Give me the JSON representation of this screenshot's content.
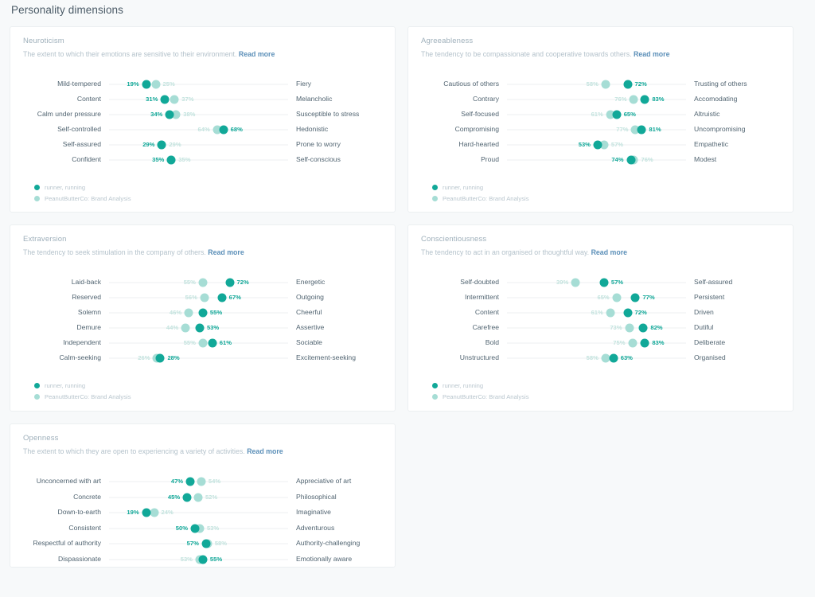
{
  "page": {
    "title": "Personality dimensions",
    "read_more_label": "Read more",
    "accent_dark": "#11a898",
    "accent_light": "#a6ddd5",
    "background": "#f7f9fa"
  },
  "legend": {
    "series_dark": "runner, running",
    "series_light": "PeanutButterCo: Brand Analysis"
  },
  "chart_data": [
    {
      "type": "scatter",
      "id": "neuroticism",
      "title": "Neuroticism",
      "description": "The extent to which their emotions are sensitive to their environment.",
      "xlim": [
        0,
        100
      ],
      "series": [
        {
          "name": "runner, running",
          "color": "#11a898"
        },
        {
          "name": "PeanutButterCo: Brand Analysis",
          "color": "#a6ddd5"
        }
      ],
      "rows": [
        {
          "left": "Mild-tempered",
          "right": "Fiery",
          "dark": 19,
          "light": 25,
          "dark_label": "19%",
          "light_label": "25%"
        },
        {
          "left": "Content",
          "right": "Melancholic",
          "dark": 31,
          "light": 37,
          "dark_label": "31%",
          "light_label": "37%"
        },
        {
          "left": "Calm under pressure",
          "right": "Susceptible to stress",
          "dark": 34,
          "light": 38,
          "dark_label": "34%",
          "light_label": "38%"
        },
        {
          "left": "Self-controlled",
          "right": "Hedonistic",
          "dark": 68,
          "light": 64,
          "dark_label": "68%",
          "light_label": "64%"
        },
        {
          "left": "Self-assured",
          "right": "Prone to worry",
          "dark": 29,
          "light": 29,
          "dark_label": "29%",
          "light_label": "29%"
        },
        {
          "left": "Confident",
          "right": "Self-conscious",
          "dark": 35,
          "light": 35,
          "dark_label": "35%",
          "light_label": "35%"
        }
      ]
    },
    {
      "type": "scatter",
      "id": "agreeableness",
      "title": "Agreeableness",
      "description": "The tendency to be compassionate and cooperative towards others.",
      "xlim": [
        0,
        100
      ],
      "series": [
        {
          "name": "runner, running",
          "color": "#11a898"
        },
        {
          "name": "PeanutButterCo: Brand Analysis",
          "color": "#a6ddd5"
        }
      ],
      "rows": [
        {
          "left": "Cautious of others",
          "right": "Trusting of others",
          "dark": 72,
          "light": 58,
          "dark_label": "72%",
          "light_label": "58%"
        },
        {
          "left": "Contrary",
          "right": "Accomodating",
          "dark": 83,
          "light": 76,
          "dark_label": "83%",
          "light_label": "76%"
        },
        {
          "left": "Self-focused",
          "right": "Altruistic",
          "dark": 65,
          "light": 61,
          "dark_label": "65%",
          "light_label": "61%"
        },
        {
          "left": "Compromising",
          "right": "Uncompromising",
          "dark": 81,
          "light": 77,
          "dark_label": "81%",
          "light_label": "77%"
        },
        {
          "left": "Hard-hearted",
          "right": "Empathetic",
          "dark": 53,
          "light": 57,
          "dark_label": "53%",
          "light_label": "57%"
        },
        {
          "left": "Proud",
          "right": "Modest",
          "dark": 74,
          "light": 76,
          "dark_label": "74%",
          "light_label": "76%"
        }
      ]
    },
    {
      "type": "scatter",
      "id": "extraversion",
      "title": "Extraversion",
      "description": "The tendency to seek stimulation in the company of others.",
      "xlim": [
        0,
        100
      ],
      "series": [
        {
          "name": "runner, running",
          "color": "#11a898"
        },
        {
          "name": "PeanutButterCo: Brand Analysis",
          "color": "#a6ddd5"
        }
      ],
      "rows": [
        {
          "left": "Laid-back",
          "right": "Energetic",
          "dark": 72,
          "light": 55,
          "dark_label": "72%",
          "light_label": "55%"
        },
        {
          "left": "Reserved",
          "right": "Outgoing",
          "dark": 67,
          "light": 56,
          "dark_label": "67%",
          "light_label": "56%"
        },
        {
          "left": "Solemn",
          "right": "Cheerful",
          "dark": 55,
          "light": 46,
          "dark_label": "55%",
          "light_label": "46%"
        },
        {
          "left": "Demure",
          "right": "Assertive",
          "dark": 53,
          "light": 44,
          "dark_label": "53%",
          "light_label": "44%"
        },
        {
          "left": "Independent",
          "right": "Sociable",
          "dark": 61,
          "light": 55,
          "dark_label": "61%",
          "light_label": "55%"
        },
        {
          "left": "Calm-seeking",
          "right": "Excitement-seeking",
          "dark": 28,
          "light": 26,
          "dark_label": "28%",
          "light_label": "26%"
        }
      ]
    },
    {
      "type": "scatter",
      "id": "conscientiousness",
      "title": "Conscientiousness",
      "description": "The tendency to act in an organised or thoughtful way.",
      "xlim": [
        0,
        100
      ],
      "series": [
        {
          "name": "runner, running",
          "color": "#11a898"
        },
        {
          "name": "PeanutButterCo: Brand Analysis",
          "color": "#a6ddd5"
        }
      ],
      "rows": [
        {
          "left": "Self-doubted",
          "right": "Self-assured",
          "dark": 57,
          "light": 39,
          "dark_label": "57%",
          "light_label": "39%"
        },
        {
          "left": "Intermittent",
          "right": "Persistent",
          "dark": 77,
          "light": 65,
          "dark_label": "77%",
          "light_label": "65%"
        },
        {
          "left": "Content",
          "right": "Driven",
          "dark": 72,
          "light": 61,
          "dark_label": "72%",
          "light_label": "61%"
        },
        {
          "left": "Carefree",
          "right": "Dutiful",
          "dark": 82,
          "light": 73,
          "dark_label": "82%",
          "light_label": "73%"
        },
        {
          "left": "Bold",
          "right": "Deliberate",
          "dark": 83,
          "light": 75,
          "dark_label": "83%",
          "light_label": "75%"
        },
        {
          "left": "Unstructured",
          "right": "Organised",
          "dark": 63,
          "light": 58,
          "dark_label": "63%",
          "light_label": "58%"
        }
      ]
    },
    {
      "type": "scatter",
      "id": "openness",
      "title": "Openness",
      "description": "The extent to which they are open to experiencing a variety of activities.",
      "xlim": [
        0,
        100
      ],
      "series": [
        {
          "name": "runner, running",
          "color": "#11a898"
        },
        {
          "name": "PeanutButterCo: Brand Analysis",
          "color": "#a6ddd5"
        }
      ],
      "rows": [
        {
          "left": "Unconcerned with art",
          "right": "Appreciative of art",
          "dark": 47,
          "light": 54,
          "dark_label": "47%",
          "light_label": "54%"
        },
        {
          "left": "Concrete",
          "right": "Philosophical",
          "dark": 45,
          "light": 52,
          "dark_label": "45%",
          "light_label": "52%"
        },
        {
          "left": "Down-to-earth",
          "right": "Imaginative",
          "dark": 19,
          "light": 24,
          "dark_label": "19%",
          "light_label": "24%"
        },
        {
          "left": "Consistent",
          "right": "Adventurous",
          "dark": 50,
          "light": 53,
          "dark_label": "50%",
          "light_label": "53%"
        },
        {
          "left": "Respectful of authority",
          "right": "Authority-challenging",
          "dark": 57,
          "light": 58,
          "dark_label": "57%",
          "light_label": "58%"
        },
        {
          "left": "Dispassionate",
          "right": "Emotionally aware",
          "dark": 55,
          "light": 53,
          "dark_label": "55%",
          "light_label": "53%"
        }
      ]
    }
  ]
}
